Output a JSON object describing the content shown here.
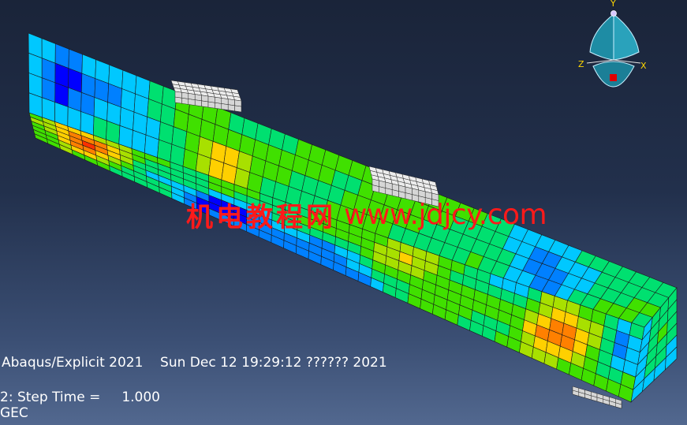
{
  "viewport": {
    "info_text": "Abaqus/Explicit 2021    Sun Dec 12 19:29:12 ?????? 2021",
    "step_text": "2: Step Time =     1.000",
    "variable_text": "GEC"
  },
  "watermark": {
    "chinese_text": "机电教程网",
    "url_text": "www.jdjcy.com",
    "color": "#ff1a1a"
  },
  "triad": {
    "y_label": "Y",
    "z_label": "Z",
    "x_label": "X",
    "axis_color": "#ffd700",
    "body_color": "#1f8fa6"
  },
  "colors": {
    "contour_scale": [
      "#0000ff",
      "#0080ff",
      "#00c8ff",
      "#00e070",
      "#40e000",
      "#a8e000",
      "#ffd000",
      "#ff8000",
      "#ff3000"
    ],
    "mesh_line": "#1a1a1a",
    "plate": "#ececec"
  }
}
